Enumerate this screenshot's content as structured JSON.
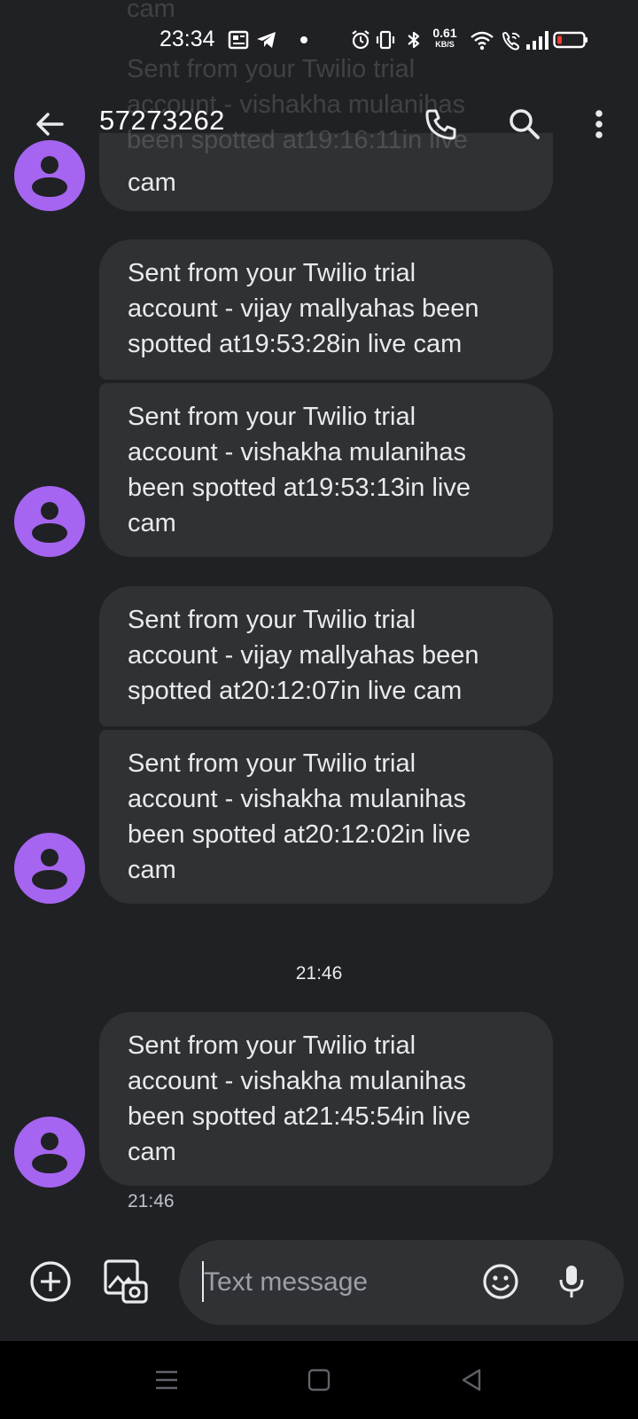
{
  "status_bar": {
    "time": "23:34",
    "net_speed_value": "0.61",
    "net_speed_unit": "KB/S",
    "icons": [
      "news-icon",
      "telegram-icon",
      "dot-icon",
      "alarm-icon",
      "vibrate-icon",
      "bluetooth-icon",
      "wifi-icon",
      "wifi-calling-icon",
      "signal-icon",
      "battery-low-icon"
    ],
    "battery_color": "#ff3b30"
  },
  "header": {
    "title": "57273262",
    "icons": [
      "back-arrow-icon",
      "phone-icon",
      "search-icon",
      "more-vert-icon"
    ]
  },
  "ghost_overlap_lines": [
    "cam",
    "Sent from your Twilio trial",
    "account - vishakha mulanihas",
    "been spotted at19:16:11in live",
    "cam"
  ],
  "messages": [
    {
      "lines": [
        "cam"
      ]
    },
    {
      "lines": [
        "Sent from your Twilio trial",
        "account - vijay mallyahas been",
        "spotted at19:53:28in live cam"
      ]
    },
    {
      "lines": [
        "Sent from your Twilio trial",
        "account - vishakha mulanihas",
        "been spotted at19:53:13in live",
        "cam"
      ]
    },
    {
      "lines": [
        "Sent from your Twilio trial",
        "account - vijay mallyahas been",
        "spotted at20:12:07in live cam"
      ]
    },
    {
      "lines": [
        "Sent from your Twilio trial",
        "account - vishakha mulanihas",
        "been spotted at20:12:02in live",
        "cam"
      ]
    },
    {
      "lines": [
        "Sent from your Twilio trial",
        "account - vishakha mulanihas",
        "been spotted at21:45:54in live",
        "cam"
      ]
    }
  ],
  "divider_time": "21:46",
  "last_message_time": "21:46",
  "compose": {
    "placeholder": "Text message",
    "icons": [
      "add-circle-icon",
      "gallery-icon",
      "emoji-icon",
      "mic-icon"
    ]
  },
  "nav_bar": {
    "icons": [
      "menu-icon",
      "home-square-icon",
      "back-triangle-icon"
    ]
  },
  "colors": {
    "background": "#202124",
    "bubble": "#303134",
    "avatar": "#a565f0",
    "nav_bar": "#000000"
  }
}
